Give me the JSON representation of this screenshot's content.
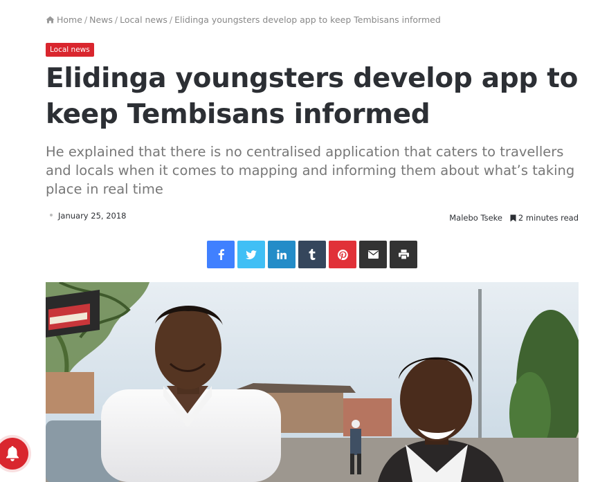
{
  "breadcrumb": {
    "home": "Home",
    "news": "News",
    "local_news": "Local news",
    "current": "Elidinga youngsters develop app to keep Tembisans informed",
    "separator": "/"
  },
  "category": "Local news",
  "article": {
    "title": "Elidinga youngsters develop app to keep Tembisans informed",
    "excerpt": "He explained that there is no centralised application that caters to travellers and locals when it comes to mapping and informing them about what’s taking place in real time",
    "date": "January 25, 2018",
    "author": "Malebo Tseke",
    "read_time": "2 minutes read"
  },
  "share": [
    {
      "name": "facebook",
      "icon": "facebook-icon",
      "color": "#4080ff"
    },
    {
      "name": "twitter",
      "icon": "twitter-icon",
      "color": "#40bff5"
    },
    {
      "name": "linkedin",
      "icon": "linkedin-icon",
      "color": "#238cc8"
    },
    {
      "name": "tumblr",
      "icon": "tumblr-icon",
      "color": "#35465c"
    },
    {
      "name": "pinterest",
      "icon": "pinterest-icon",
      "color": "#e13138"
    },
    {
      "name": "email",
      "icon": "envelope-icon",
      "color": "#333333"
    },
    {
      "name": "print",
      "icon": "printer-icon",
      "color": "#333333"
    }
  ],
  "colors": {
    "accent": "#d9262e",
    "text": "#2c2f34",
    "muted": "#777777"
  }
}
